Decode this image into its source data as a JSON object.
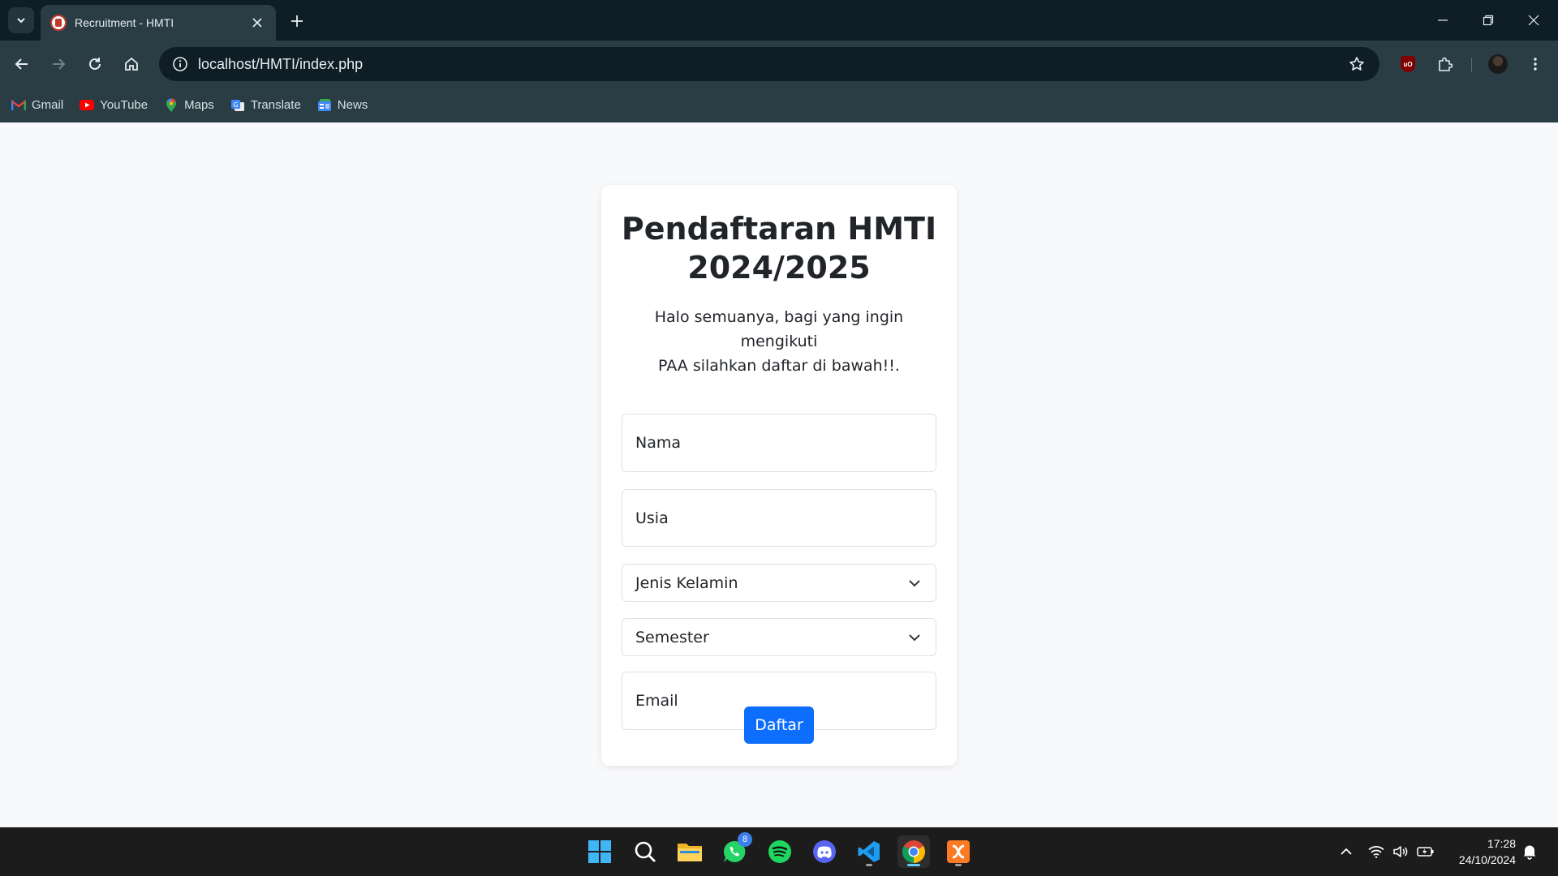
{
  "browser": {
    "tab_title": "Recruitment - HMTI",
    "url": "localhost/HMTI/index.php",
    "bookmarks": [
      {
        "label": "Gmail",
        "icon": "gmail-icon"
      },
      {
        "label": "YouTube",
        "icon": "youtube-icon"
      },
      {
        "label": "Maps",
        "icon": "maps-icon"
      },
      {
        "label": "Translate",
        "icon": "translate-icon"
      },
      {
        "label": "News",
        "icon": "news-icon"
      }
    ],
    "extension_badge": "uO"
  },
  "form": {
    "title_line1": "Pendaftaran HMTI",
    "title_line2": "2024/2025",
    "description_line1": "Halo semuanya, bagi yang ingin mengikuti",
    "description_line2": "PAA silahkan daftar di bawah!!.",
    "nama_placeholder": "Nama",
    "usia_placeholder": "Usia",
    "gender_selected": "Jenis Kelamin",
    "semester_selected": "Semester",
    "email_placeholder": "Email",
    "submit_label": "Daftar"
  },
  "colors": {
    "primary": "#0d6efd",
    "chrome_dark": "#0f1e26",
    "chrome_toolbar": "#2a3d45",
    "page_bg": "#f8f9fa"
  },
  "taskbar": {
    "apps": [
      "windows-start-icon",
      "search-icon",
      "file-explorer-icon",
      "whatsapp-icon",
      "spotify-icon",
      "discord-icon",
      "vscode-icon",
      "chrome-icon",
      "xampp-icon"
    ],
    "whatsapp_badge": "8",
    "time": "17:28",
    "date": "24/10/2024"
  }
}
